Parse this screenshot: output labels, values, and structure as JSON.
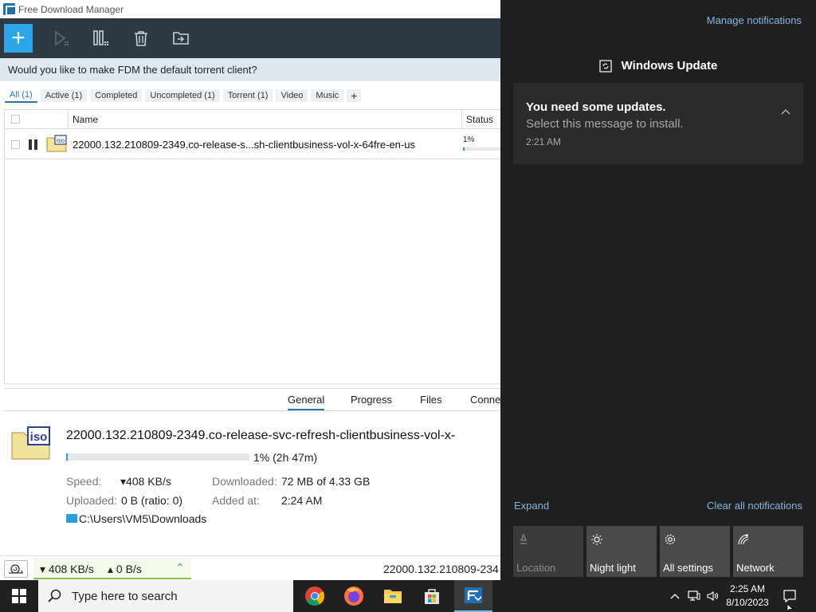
{
  "fdm": {
    "window_title": "Free Download Manager",
    "banner_text": "Would you like to make FDM the default torrent client?",
    "filters": [
      {
        "label": "All (1)",
        "active": true
      },
      {
        "label": "Active (1)",
        "active": false
      },
      {
        "label": "Completed",
        "active": false
      },
      {
        "label": "Uncompleted (1)",
        "active": false
      },
      {
        "label": "Torrent (1)",
        "active": false
      },
      {
        "label": "Video",
        "active": false
      },
      {
        "label": "Music",
        "active": false
      },
      {
        "label": "+",
        "active": false
      }
    ],
    "list": {
      "col_name": "Name",
      "col_status": "Status",
      "rows": [
        {
          "name": "22000.132.210809-2349.co-release-s...sh-clientbusiness-vol-x-64fre-en-us",
          "status_pct": "1%",
          "progress_fraction": 0.01
        }
      ]
    },
    "details": {
      "tabs": [
        "General",
        "Progress",
        "Files",
        "Conne"
      ],
      "active_tab": "General",
      "file_name": "22000.132.210809-2349.co-release-svc-refresh-clientbusiness-vol-x-",
      "progress_fraction": 0.01,
      "progress_text": "1% (2h 47m)",
      "speed_label": "Speed:",
      "speed_value": "▾408 KB/s",
      "downloaded_label": "Downloaded:",
      "downloaded_value": "72 MB of 4.33 GB",
      "uploaded_label": "Uploaded:",
      "uploaded_value": "0 B (ratio: 0)",
      "added_label": "Added at:",
      "added_value": "2:24 AM",
      "path": "C:\\Users\\VM5\\Downloads"
    },
    "status_bar": {
      "download_speed": "▾ 408 KB/s",
      "upload_speed": "▴ 0 B/s",
      "current_file": "22000.132.210809-234"
    }
  },
  "action_center": {
    "manage_link": "Manage notifications",
    "group_title": "Windows Update",
    "notification": {
      "title": "You need some updates.",
      "body": "Select this message to install.",
      "time": "2:21 AM"
    },
    "expand_link": "Expand",
    "clear_link": "Clear all notifications",
    "quick_actions": [
      {
        "label": "Location",
        "icon": "location-icon",
        "enabled": false
      },
      {
        "label": "Night light",
        "icon": "night-light-icon",
        "enabled": true
      },
      {
        "label": "All settings",
        "icon": "settings-gear-icon",
        "enabled": true
      },
      {
        "label": "Network",
        "icon": "network-icon",
        "enabled": true
      }
    ]
  },
  "taskbar": {
    "search_placeholder": "Type here to search",
    "apps": [
      "chrome-icon",
      "firefox-icon",
      "file-explorer-icon",
      "microsoft-store-icon",
      "fdm-icon"
    ],
    "time": "2:25 AM",
    "date": "8/10/2023"
  },
  "colors": {
    "accent": "#2aa5e8",
    "toolbar_bg": "#2d3a46",
    "action_center_bg": "#1f1f1f",
    "link_blue": "#8ab4e3"
  }
}
